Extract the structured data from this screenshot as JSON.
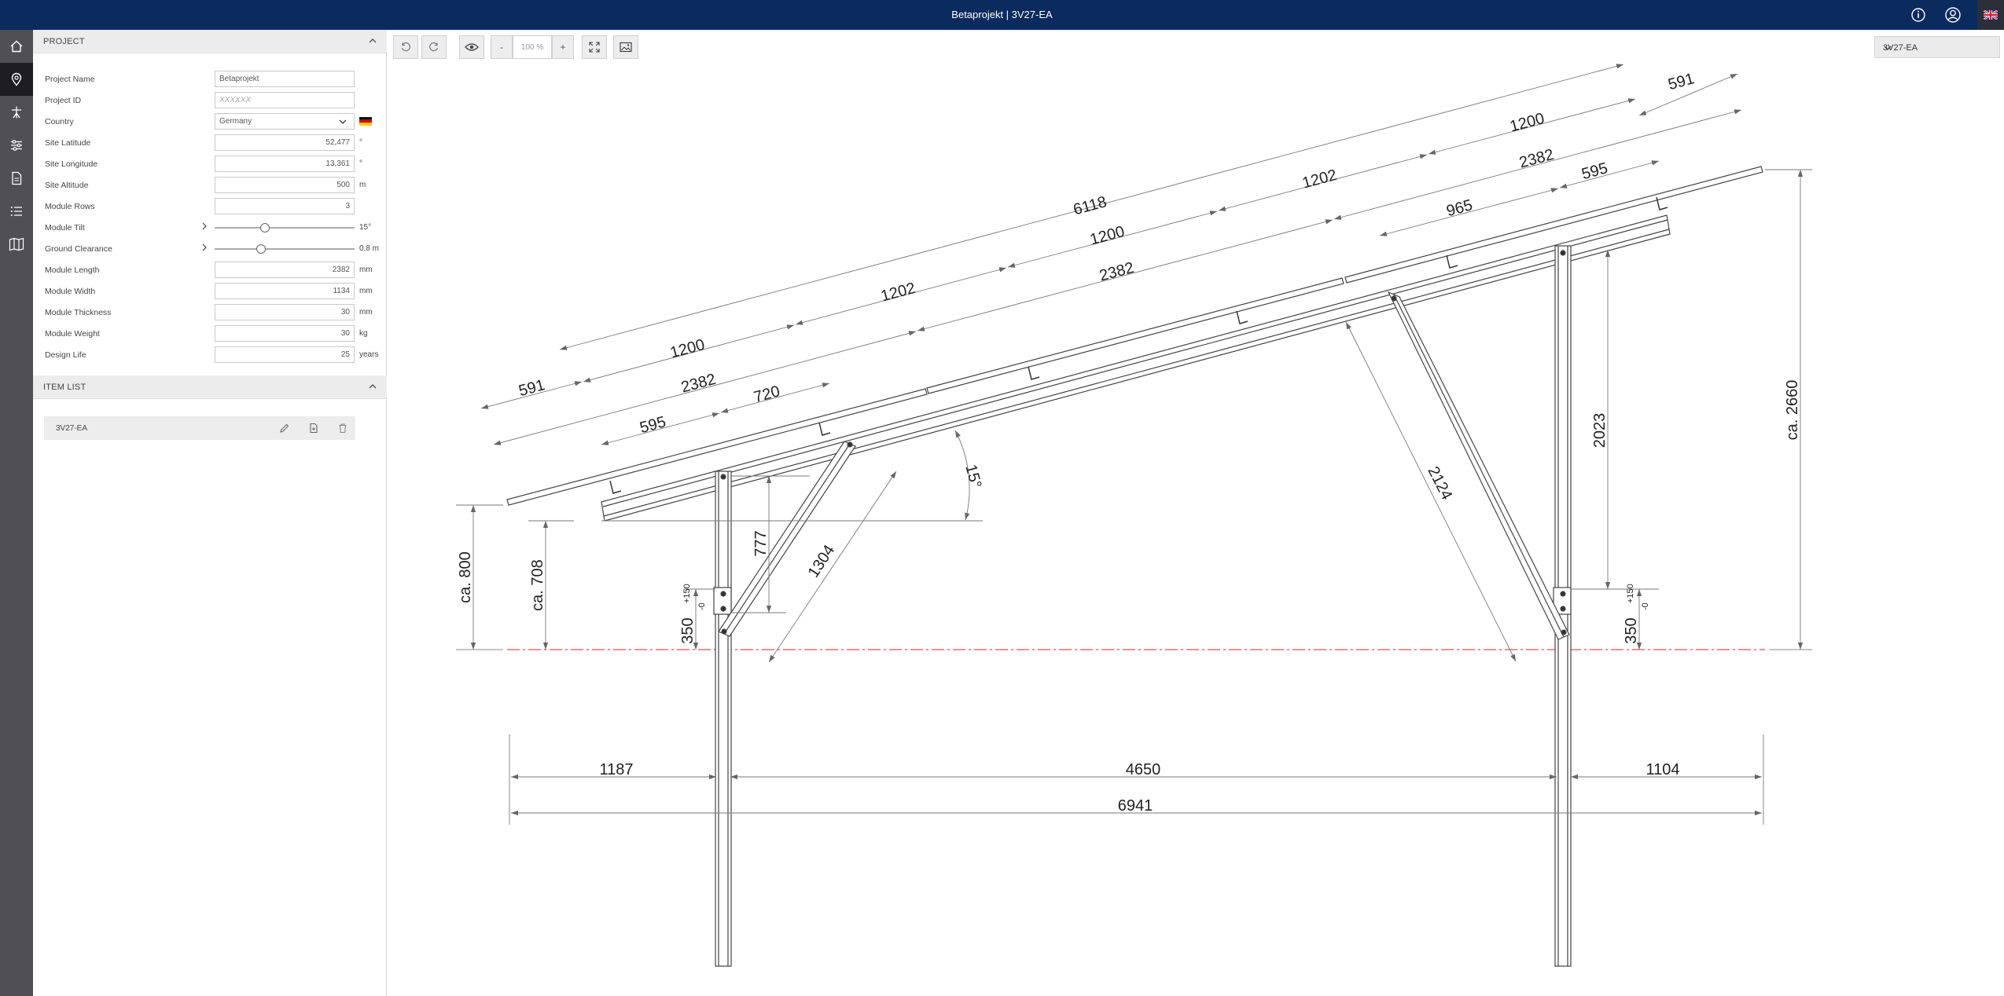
{
  "header": {
    "title": "Betaprojekt | 3V27-EA"
  },
  "icons": {
    "info": "info-icon",
    "user": "user-icon",
    "flag": "uk-flag-icon",
    "rail": [
      "home-icon",
      "location-pin-icon",
      "structure-icon",
      "sliders-icon",
      "document-icon",
      "list-icon",
      "map-icon"
    ]
  },
  "colors": {
    "header": "#0b2a5e",
    "rail": "#4f4f55",
    "ground_line": "#e05050"
  },
  "project": {
    "section_title": "PROJECT",
    "fields": {
      "project_name": {
        "label": "Project Name",
        "value": "Betaprojekt"
      },
      "project_id": {
        "label": "Project ID",
        "placeholder": "XXXXXX"
      },
      "country": {
        "label": "Country",
        "value": "Germany"
      },
      "latitude": {
        "label": "Site Latitude",
        "value": "52,477",
        "unit": "°"
      },
      "longitude": {
        "label": "Site Longitude",
        "value": "13,361",
        "unit": "°"
      },
      "altitude": {
        "label": "Site Altitude",
        "value": "500",
        "unit": "m"
      },
      "rows": {
        "label": "Module Rows",
        "value": "3"
      },
      "tilt": {
        "label": "Module Tilt",
        "value": "15°",
        "slider_fraction": 0.36
      },
      "clearance": {
        "label": "Ground Clearance",
        "value": "0.8 m",
        "slider_fraction": 0.33
      },
      "length": {
        "label": "Module Length",
        "value": "2382",
        "unit": "mm"
      },
      "width": {
        "label": "Module Width",
        "value": "1134",
        "unit": "mm"
      },
      "thickness": {
        "label": "Module Thickness",
        "value": "30",
        "unit": "mm"
      },
      "weight": {
        "label": "Module Weight",
        "value": "30",
        "unit": "kg"
      },
      "life": {
        "label": "Design Life",
        "value": "25",
        "unit": "years"
      }
    }
  },
  "item_list": {
    "section_title": "ITEM LIST",
    "items": [
      {
        "name": "3V27-EA"
      }
    ]
  },
  "toolbar": {
    "zoom": "100 %",
    "zoom_out": "-",
    "zoom_in": "+"
  },
  "variant_select": {
    "value": "3V27-EA"
  },
  "drawing": {
    "top_dims": [
      "6118",
      "591",
      "1200",
      "1202",
      "1200",
      "1202",
      "1200",
      "591"
    ],
    "mid_dims": [
      "2382",
      "2382",
      "2382"
    ],
    "low_dims": [
      "595",
      "720",
      "965",
      "595"
    ],
    "angle": "15°",
    "front_height": "ca. 800",
    "front_clearance": "ca. 708",
    "front_post": "777",
    "front_brace": "1304",
    "rear_brace": "2124",
    "rear_height": "2023",
    "total_height": "ca. 2660",
    "embed_front": "350",
    "embed_rear": "350",
    "tol_plus": "+150",
    "tol_minus": "-0",
    "bottom_dims": {
      "front": "1187",
      "span": "4650",
      "rear": "1104",
      "total": "6941"
    }
  }
}
